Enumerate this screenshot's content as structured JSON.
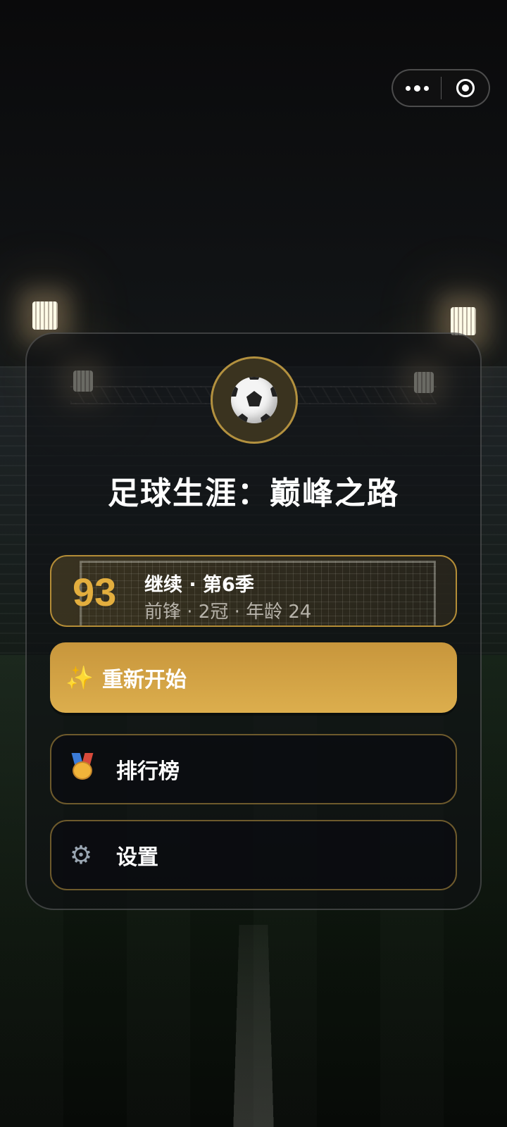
{
  "title": "足球生涯：巅峰之路",
  "capsule": {
    "more_icon": "more-dots-icon",
    "close_icon": "target-close-icon"
  },
  "continue_card": {
    "rating": "93",
    "title": "继续 · 第6季",
    "subtitle": "前锋 · 2冠 · 年龄 24"
  },
  "buttons": {
    "restart": {
      "icon": "sparkles-icon",
      "label": "重新开始"
    },
    "leaderboard": {
      "icon": "medal-icon",
      "label": "排行榜"
    },
    "settings": {
      "icon": "gear-icon",
      "label": "设置"
    }
  },
  "colors": {
    "accent_gold": "#dcae4d",
    "rating_gold": "#e3ae3e",
    "border_gold": "#b48d37"
  }
}
